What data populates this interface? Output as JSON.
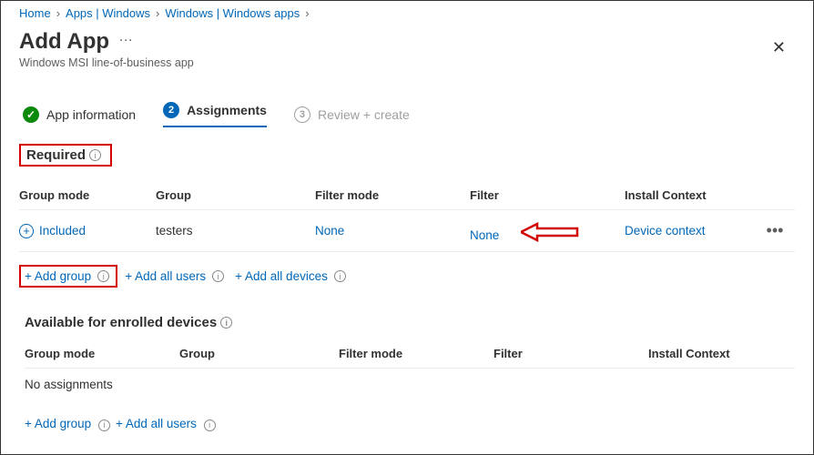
{
  "breadcrumb": {
    "home": "Home",
    "apps_windows": "Apps | Windows",
    "windows_apps": "Windows | Windows apps"
  },
  "header": {
    "title": "Add App",
    "subtitle": "Windows MSI line-of-business app"
  },
  "wizard": {
    "step1": "App information",
    "step2_num": "2",
    "step2": "Assignments",
    "step3_num": "3",
    "step3": "Review + create"
  },
  "required": {
    "heading": "Required",
    "cols": {
      "group_mode": "Group mode",
      "group": "Group",
      "filter_mode": "Filter mode",
      "filter": "Filter",
      "install_context": "Install Context"
    },
    "row": {
      "group_mode": "Included",
      "group": "testers",
      "filter_mode": "None",
      "filter": "None",
      "install_context": "Device context"
    },
    "add_group": "+ Add group",
    "add_all_users": "+ Add all users",
    "add_all_devices": "+ Add all devices"
  },
  "available": {
    "heading": "Available for enrolled devices",
    "cols": {
      "group_mode": "Group mode",
      "group": "Group",
      "filter_mode": "Filter mode",
      "filter": "Filter",
      "install_context": "Install Context"
    },
    "empty": "No assignments",
    "add_group": "+ Add group",
    "add_all_users": "+ Add all users"
  }
}
